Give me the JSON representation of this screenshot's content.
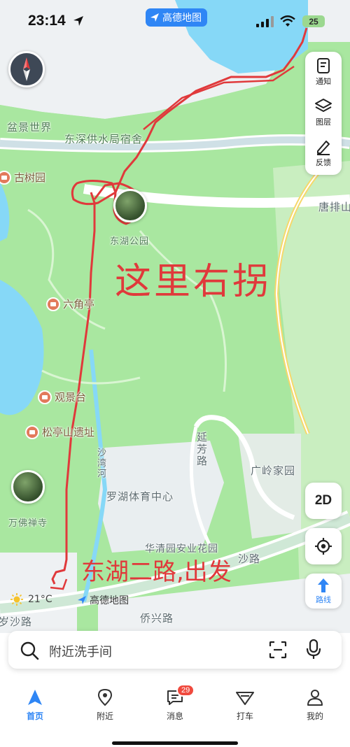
{
  "status_bar": {
    "time": "23:14",
    "app_name": "高德地图",
    "battery": "25"
  },
  "map": {
    "places": {
      "penjing": "盆景世界",
      "water_bureau": "东深供水局宿舍",
      "gushu": "古树园",
      "donghu_park": "东湖公园",
      "liujiao": "六角亭",
      "guanjing": "观景台",
      "songting": "松亭山遗址",
      "luohu_sports": "罗湖体育中心",
      "guangling": "广岭家园",
      "wanfo": "万佛禅寺",
      "huaqing": "华清园安业花园",
      "tangpai": "唐排山"
    },
    "roads": {
      "yanfang": "延芳路",
      "shawan": "沙湾河",
      "shawan_road": "沙路",
      "shawan_road_left": "岁沙路",
      "qiaoxing": "侨兴路"
    },
    "annotations": {
      "turn_right": "这里右拐",
      "start": "东湖二路,出发"
    }
  },
  "tools": {
    "notify": "通知",
    "layers": "图层",
    "feedback": "反馈"
  },
  "controls": {
    "mode_2d": "2D",
    "route": "路线"
  },
  "weather": {
    "temp": "21°C"
  },
  "watermark": "高德地图",
  "search": {
    "placeholder": "附近洗手间"
  },
  "tabs": [
    {
      "label": "首页",
      "icon": "home-navigation-icon",
      "active": true
    },
    {
      "label": "附近",
      "icon": "location-pin-icon"
    },
    {
      "label": "消息",
      "icon": "message-icon",
      "badge": "29"
    },
    {
      "label": "打车",
      "icon": "taxi-icon"
    },
    {
      "label": "我的",
      "icon": "user-icon"
    }
  ],
  "colors": {
    "accent": "#2f86f5",
    "park": "#a9e7a0",
    "water": "#86d8f7",
    "annotation": "#e0393b",
    "badge": "#f04a3e"
  }
}
